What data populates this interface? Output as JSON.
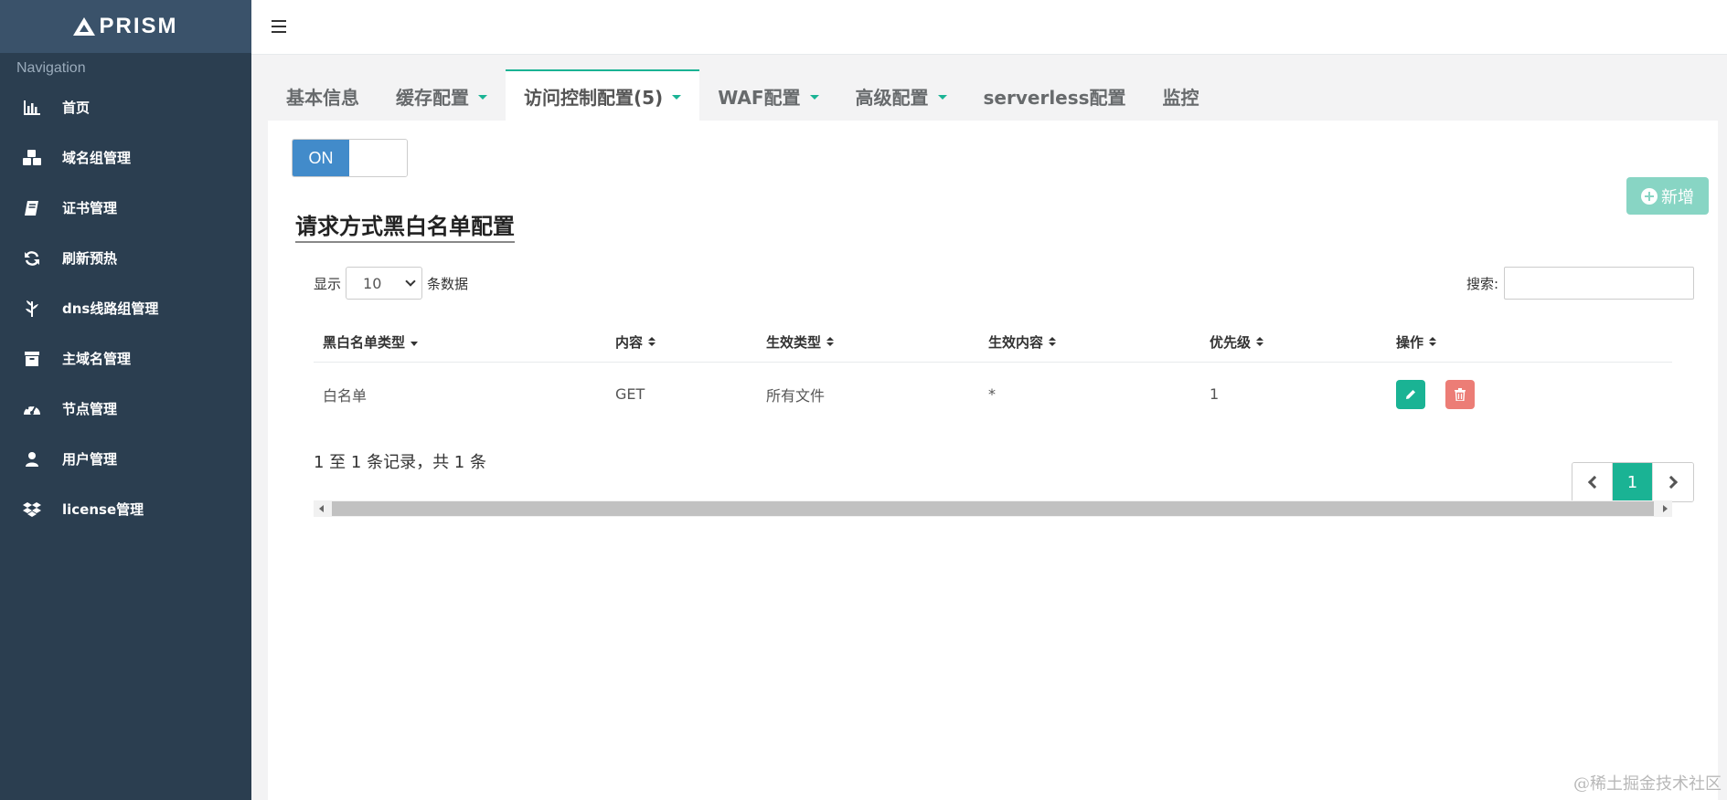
{
  "brand": {
    "name": "PRISM"
  },
  "sidebar": {
    "heading": "Navigation",
    "items": [
      {
        "label": "首页",
        "icon": "bar-chart-icon"
      },
      {
        "label": "域名组管理",
        "icon": "cubes-icon"
      },
      {
        "label": "证书管理",
        "icon": "book-icon"
      },
      {
        "label": "刷新预热",
        "icon": "refresh-icon"
      },
      {
        "label": "dns线路组管理",
        "icon": "plant-icon"
      },
      {
        "label": "主域名管理",
        "icon": "archive-icon"
      },
      {
        "label": "节点管理",
        "icon": "dashboard-icon"
      },
      {
        "label": "用户管理",
        "icon": "user-icon"
      },
      {
        "label": "license管理",
        "icon": "dropbox-icon"
      }
    ]
  },
  "tabs": [
    {
      "label": "基本信息"
    },
    {
      "label": "缓存配置"
    },
    {
      "label": "访问控制配置(5)"
    },
    {
      "label": "WAF配置"
    },
    {
      "label": "高级配置"
    },
    {
      "label": "serverless配置"
    },
    {
      "label": "监控"
    }
  ],
  "toggle": {
    "on_label": "ON"
  },
  "add_button": {
    "label": "新增"
  },
  "section": {
    "title": "请求方式黑白名单配置"
  },
  "table_controls": {
    "show_prefix": "显示",
    "page_size": "10",
    "show_suffix": "条数据",
    "search_label": "搜索:"
  },
  "table": {
    "headers": [
      "黑白名单类型",
      "内容",
      "生效类型",
      "生效内容",
      "优先级",
      "操作"
    ],
    "rows": [
      {
        "type": "白名单",
        "content": "GET",
        "effect_type": "所有文件",
        "effect_content": "*",
        "priority": "1"
      }
    ]
  },
  "footer": {
    "info": "1 至 1 条记录，共 1 条",
    "current_page": "1"
  },
  "watermark": "@稀土掘金技术社区",
  "colors": {
    "sidebar": "#2b3e50",
    "accent": "#1ab394",
    "toggle_on": "#428bca",
    "delete": "#ec7d76"
  }
}
